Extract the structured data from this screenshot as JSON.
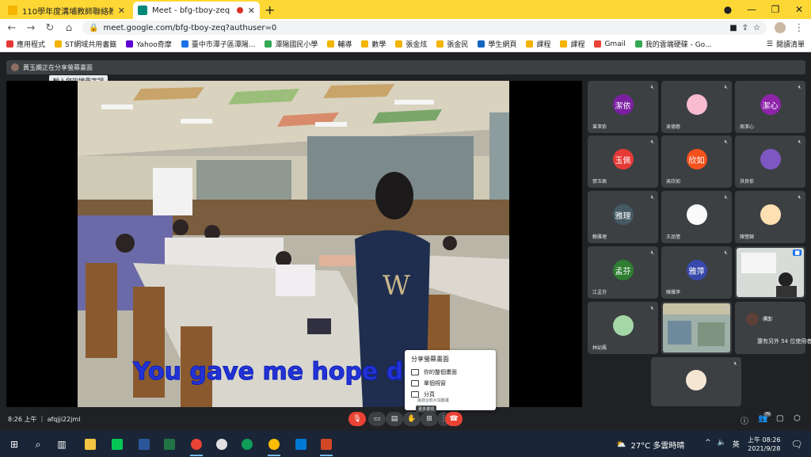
{
  "tabs": [
    {
      "title": "110學年度溝埔教師聯絡教室",
      "active": false,
      "fav": "#f4b400"
    },
    {
      "title": "Meet - bfg-tboy-zeq",
      "active": true,
      "fav": "#00897b"
    }
  ],
  "address": {
    "url": "meet.google.com/bfg-tboy-zeq?authuser=0"
  },
  "bookmarks": [
    {
      "label": "應用程式",
      "color": "#e53935"
    },
    {
      "label": "ST網域共用書籤",
      "color": "#f4b400"
    },
    {
      "label": "Yahoo奇摩",
      "color": "#6001d2"
    },
    {
      "label": "臺中市潭子區潭陽...",
      "color": "#1a73e8"
    },
    {
      "label": "潭陽國民小學",
      "color": "#34a853"
    },
    {
      "label": "輔導",
      "color": "#f4b400"
    },
    {
      "label": "數學",
      "color": "#f4b400"
    },
    {
      "label": "張金炫",
      "color": "#f4b400"
    },
    {
      "label": "張金民",
      "color": "#f4b400"
    },
    {
      "label": "學生網頁",
      "color": "#1565c0"
    },
    {
      "label": "課程",
      "color": "#f4b400"
    },
    {
      "label": "課程",
      "color": "#f4b400"
    },
    {
      "label": "Gmail",
      "color": "#ea4335"
    },
    {
      "label": "我的雲端硬碟 - Go...",
      "color": "#34a853"
    }
  ],
  "reading_list": "閱讀清單",
  "meet": {
    "presenting_text": "黃玉嫻正在分享螢幕畫面",
    "tooltip": "輸入您的搜尋字詞",
    "subtitle": "You gave me hope de",
    "share_menu": {
      "header": "分享螢幕畫面",
      "items": [
        "你的整個畫面",
        "單個視窗",
        "分頁"
      ],
      "sub": "最適合影片與動畫"
    },
    "tiles": [
      {
        "name": "曾潔依",
        "initials": "潔依",
        "color": "#7b1fa2"
      },
      {
        "name": "吳德慈",
        "initials": "",
        "color": "#f8bbd0",
        "pic": true
      },
      {
        "name": "周潔心",
        "initials": "潔心",
        "color": "#8e24aa"
      },
      {
        "name": "張玉佩",
        "initials": "玉佩",
        "color": "#e53935"
      },
      {
        "name": "吳欣如",
        "initials": "欣如",
        "color": "#f4511e"
      },
      {
        "name": "洪良依",
        "initials": "",
        "color": "#7e57c2",
        "pic": true
      },
      {
        "name": "賴雅理",
        "initials": "雅理",
        "color": "#455a64"
      },
      {
        "name": "王品瑩",
        "initials": "",
        "color": "#fafafa",
        "pic": true
      },
      {
        "name": "陳瑩錦",
        "initials": "",
        "color": "#ffe0b2",
        "pic": true
      },
      {
        "name": "江孟芬",
        "initials": "孟芬",
        "color": "#2e7d32"
      },
      {
        "name": "陳雅萍",
        "initials": "雅萍",
        "color": "#3949ab"
      },
      {
        "name": "",
        "initials": "",
        "video": true
      },
      {
        "name": "林幼鳳",
        "initials": "",
        "color": "#a5d6a7",
        "pic": true
      },
      {
        "name": "",
        "initials": "",
        "video2": true
      },
      {
        "name": "",
        "initials": "",
        "others": true
      },
      {
        "name": "",
        "initials": "",
        "color": "#f5e6d3",
        "pic": true
      }
    ],
    "others_text": "還有另外 54 位使用者",
    "others_avatar_label": "黃玉",
    "clock": "8:26 上午 ｜ afqjji22jml",
    "controls_tip": "更多選項",
    "people_count": "70"
  },
  "taskbar": {
    "weather": "27°C  多雲時晴",
    "ime": "英",
    "time": "上午 08:26",
    "date": "2021/9/28"
  }
}
